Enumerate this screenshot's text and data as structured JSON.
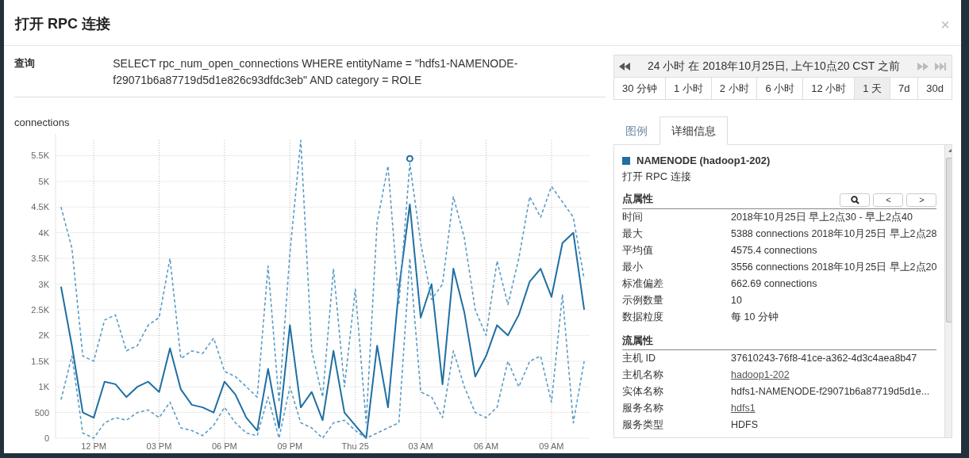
{
  "dialog": {
    "title": "打开 RPC 连接",
    "close": "×"
  },
  "query": {
    "label": "查询",
    "text": "SELECT rpc_num_open_connections WHERE entityName = \"hdfs1-NAMENODE-f29071b6a87719d5d1e826c93dfdc3eb\" AND category = ROLE"
  },
  "time_range": {
    "caption": "24 小时 在 2018年10月25日, 上午10点20 CST 之前",
    "presets": [
      {
        "label": "30 分钟",
        "selected": false
      },
      {
        "label": "1 小时",
        "selected": false
      },
      {
        "label": "2 小时",
        "selected": false
      },
      {
        "label": "6 小时",
        "selected": false
      },
      {
        "label": "12 小时",
        "selected": false
      },
      {
        "label": "1 天",
        "selected": true
      },
      {
        "label": "7d",
        "selected": false
      },
      {
        "label": "30d",
        "selected": false
      }
    ]
  },
  "chart": {
    "chart_data": {
      "type": "line",
      "ylabel": "connections",
      "ylim": [
        0,
        5800
      ],
      "categories": [
        null,
        null,
        null,
        "12 PM",
        null,
        null,
        null,
        null,
        null,
        "03 PM",
        null,
        null,
        null,
        null,
        null,
        "06 PM",
        null,
        null,
        null,
        null,
        null,
        "09 PM",
        null,
        null,
        null,
        null,
        null,
        "Thu 25",
        null,
        null,
        null,
        null,
        null,
        "03 AM",
        null,
        null,
        null,
        null,
        null,
        "06 AM",
        null,
        null,
        null,
        null,
        null,
        "09 AM",
        null,
        null,
        null
      ],
      "series": [
        {
          "color": "#1f6fa3",
          "line_style": "solid",
          "values": [
            2950,
            1800,
            500,
            400,
            1100,
            1050,
            800,
            1000,
            1100,
            900,
            1750,
            950,
            650,
            600,
            500,
            1100,
            850,
            400,
            150,
            1350,
            200,
            2200,
            600,
            900,
            350,
            1700,
            500,
            250,
            0,
            1800,
            600,
            2900,
            4550,
            2350,
            3000,
            1050,
            3300,
            2450,
            1200,
            1600,
            2200,
            2000,
            2400,
            3050,
            3300,
            2750,
            3800,
            4000,
            2500
          ]
        },
        {
          "color": "#5b9cc4",
          "line_style": "dashed",
          "values": [
            4500,
            3700,
            1600,
            1500,
            2300,
            2400,
            1700,
            1800,
            2200,
            2350,
            3500,
            1550,
            1700,
            1650,
            1950,
            1300,
            1200,
            1000,
            800,
            3350,
            700,
            3600,
            5800,
            1700,
            800,
            3300,
            1000,
            2900,
            300,
            4200,
            5300,
            2600,
            5350,
            3800,
            2700,
            3000,
            4700,
            3900,
            2500,
            2000,
            3450,
            2600,
            3500,
            4700,
            4300,
            4900,
            4600,
            4300,
            3100
          ]
        },
        {
          "color": "#5b9cc4",
          "line_style": "dashed",
          "values": [
            750,
            1600,
            100,
            0,
            300,
            400,
            350,
            500,
            550,
            400,
            700,
            200,
            150,
            50,
            250,
            600,
            300,
            100,
            50,
            800,
            0,
            1000,
            300,
            200,
            0,
            300,
            350,
            150,
            0,
            100,
            200,
            300,
            3500,
            900,
            800,
            400,
            1700,
            1000,
            500,
            400,
            600,
            1500,
            1000,
            1500,
            1600,
            700,
            2800,
            300,
            1500
          ]
        }
      ],
      "yticks": [
        {
          "value": 0,
          "label": "0"
        },
        {
          "value": 500,
          "label": "500"
        },
        {
          "value": 1000,
          "label": "1K"
        },
        {
          "value": 1500,
          "label": "1.5K"
        },
        {
          "value": 2000,
          "label": "2K"
        },
        {
          "value": 2500,
          "label": "2.5K"
        },
        {
          "value": 3000,
          "label": "3K"
        },
        {
          "value": 3500,
          "label": "3.5K"
        },
        {
          "value": 4000,
          "label": "4K"
        },
        {
          "value": 4500,
          "label": "4.5K"
        },
        {
          "value": 5000,
          "label": "5K"
        },
        {
          "value": 5500,
          "label": "5.5K"
        }
      ],
      "grid": true
    }
  },
  "tabs": [
    {
      "label": "图例",
      "selected": false
    },
    {
      "label": "详细信息",
      "selected": true
    }
  ],
  "details": {
    "series": "NAMENODE (hadoop1-202)",
    "metric": "打开 RPC 连接",
    "sections": [
      {
        "title": "点属性",
        "buttons": [
          {
            "kind": "zoom"
          },
          {
            "kind": "text",
            "label": "<"
          },
          {
            "kind": "text",
            "label": ">"
          }
        ],
        "rows": [
          {
            "label": "时间",
            "value": "2018年10月25日 早上2点30 - 早上2点40",
            "kind": "text"
          },
          {
            "label": "最大",
            "value": "5388 connections 2018年10月25日 早上2点28",
            "kind": "text"
          },
          {
            "label": "平均值",
            "value": "4575.4 connections",
            "kind": "text"
          },
          {
            "label": "最小",
            "value": "3556 connections 2018年10月25日 早上2点20",
            "kind": "text"
          },
          {
            "label": "标准偏差",
            "value": "662.69 connections",
            "kind": "text"
          },
          {
            "label": "示例数量",
            "value": "10",
            "kind": "text"
          },
          {
            "label": "数据粒度",
            "value": "每 10 分钟",
            "kind": "text"
          }
        ]
      },
      {
        "title": "流属性",
        "rows": [
          {
            "label": "主机 ID",
            "value": "37610243-76f8-41ce-a362-4d3c4aea8b47",
            "kind": "text"
          },
          {
            "label": "主机名称",
            "value": "hadoop1-202",
            "kind": "link"
          },
          {
            "label": "实体名称",
            "value": "hdfs1-NAMENODE-f29071b6a87719d5d1e...",
            "kind": "text"
          },
          {
            "label": "服务名称",
            "value": "hdfs1",
            "kind": "link"
          },
          {
            "label": "服务类型",
            "value": "HDFS",
            "kind": "text"
          }
        ]
      }
    ]
  }
}
